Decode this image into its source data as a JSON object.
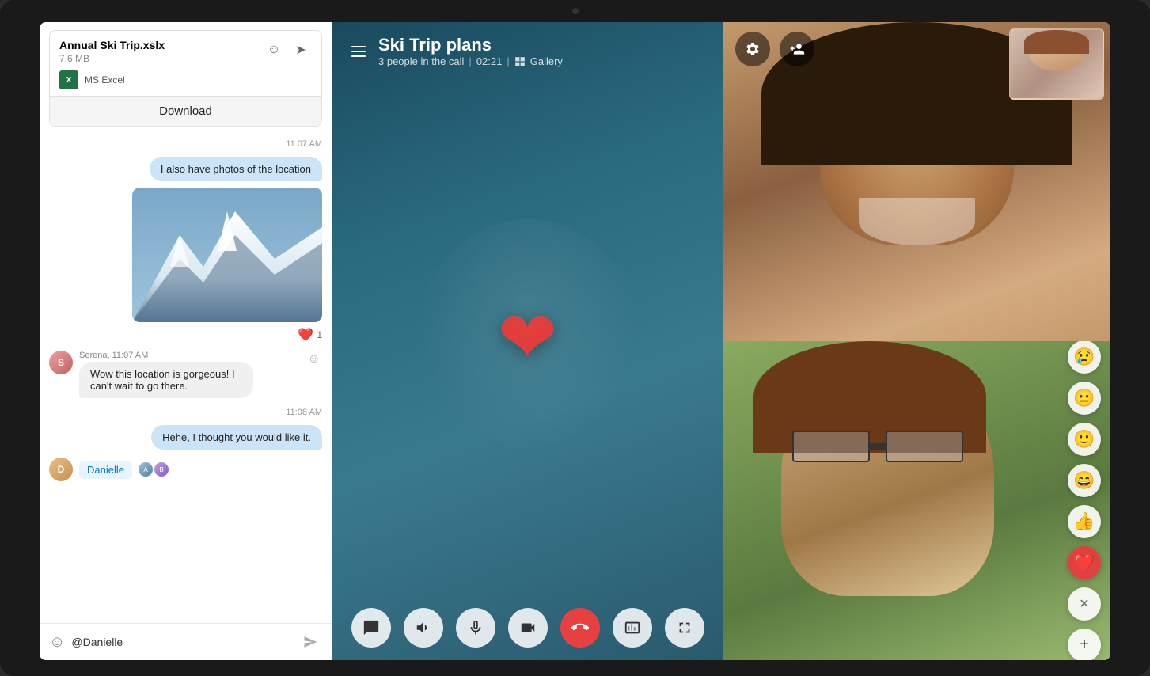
{
  "device": {
    "camera_label": "camera"
  },
  "file_attachment": {
    "name": "Annual Ski Trip.xslx",
    "size": "7,6 MB",
    "type": "MS Excel",
    "download_label": "Download",
    "forward_icon": "forward",
    "emoji_icon": "emoji"
  },
  "chat": {
    "messages": [
      {
        "id": "msg1",
        "type": "time",
        "text": "11:07 AM"
      },
      {
        "id": "msg2",
        "type": "bubble-right",
        "text": "I also have photos of the location"
      },
      {
        "id": "msg3",
        "type": "image",
        "alt": "Mountain photo"
      },
      {
        "id": "msg4",
        "type": "reaction",
        "emoji": "❤️",
        "count": "1"
      },
      {
        "id": "msg5",
        "type": "left",
        "sender": "Serena",
        "time": "11:07 AM",
        "text": "Wow this location is gorgeous! I can't wait to go there."
      },
      {
        "id": "msg6",
        "type": "time",
        "text": "11:08 AM"
      },
      {
        "id": "msg7",
        "type": "bubble-right",
        "text": "Hehe, I thought you would like it."
      }
    ],
    "mention": {
      "name": "Danielle",
      "color": "#0078d4"
    },
    "input": {
      "placeholder": "@Danielle",
      "value": "@Danielle"
    },
    "emoji_btn": "😊",
    "send_icon": "send"
  },
  "call": {
    "title": "Ski Trip plans",
    "meta": {
      "people_count": "3 people in the call",
      "duration": "02:21",
      "view_mode": "Gallery"
    },
    "heart_emoji": "❤",
    "controls": {
      "chat_icon": "💬",
      "speaker_icon": "🔊",
      "mic_icon": "🎤",
      "video_icon": "📹",
      "end_call_icon": "📵",
      "share_icon": "⧉",
      "screen_icon": "🖥"
    }
  },
  "video_grid": {
    "top_controls": {
      "settings_icon": "⚙",
      "add_person_icon": "👤+"
    },
    "participants": [
      {
        "id": "p1",
        "name": "Person 1"
      },
      {
        "id": "p2",
        "name": "Person 2 (PIP)"
      },
      {
        "id": "p3",
        "name": "Person 3"
      }
    ],
    "emoji_reactions": [
      {
        "emoji": "😢",
        "label": "sad"
      },
      {
        "emoji": "😐",
        "label": "neutral"
      },
      {
        "emoji": "🙂",
        "label": "smile"
      },
      {
        "emoji": "😄",
        "label": "grin"
      },
      {
        "emoji": "👍",
        "label": "thumbsup"
      },
      {
        "emoji": "❤️",
        "label": "heart"
      }
    ],
    "close_label": "✕",
    "add_label": "+"
  }
}
